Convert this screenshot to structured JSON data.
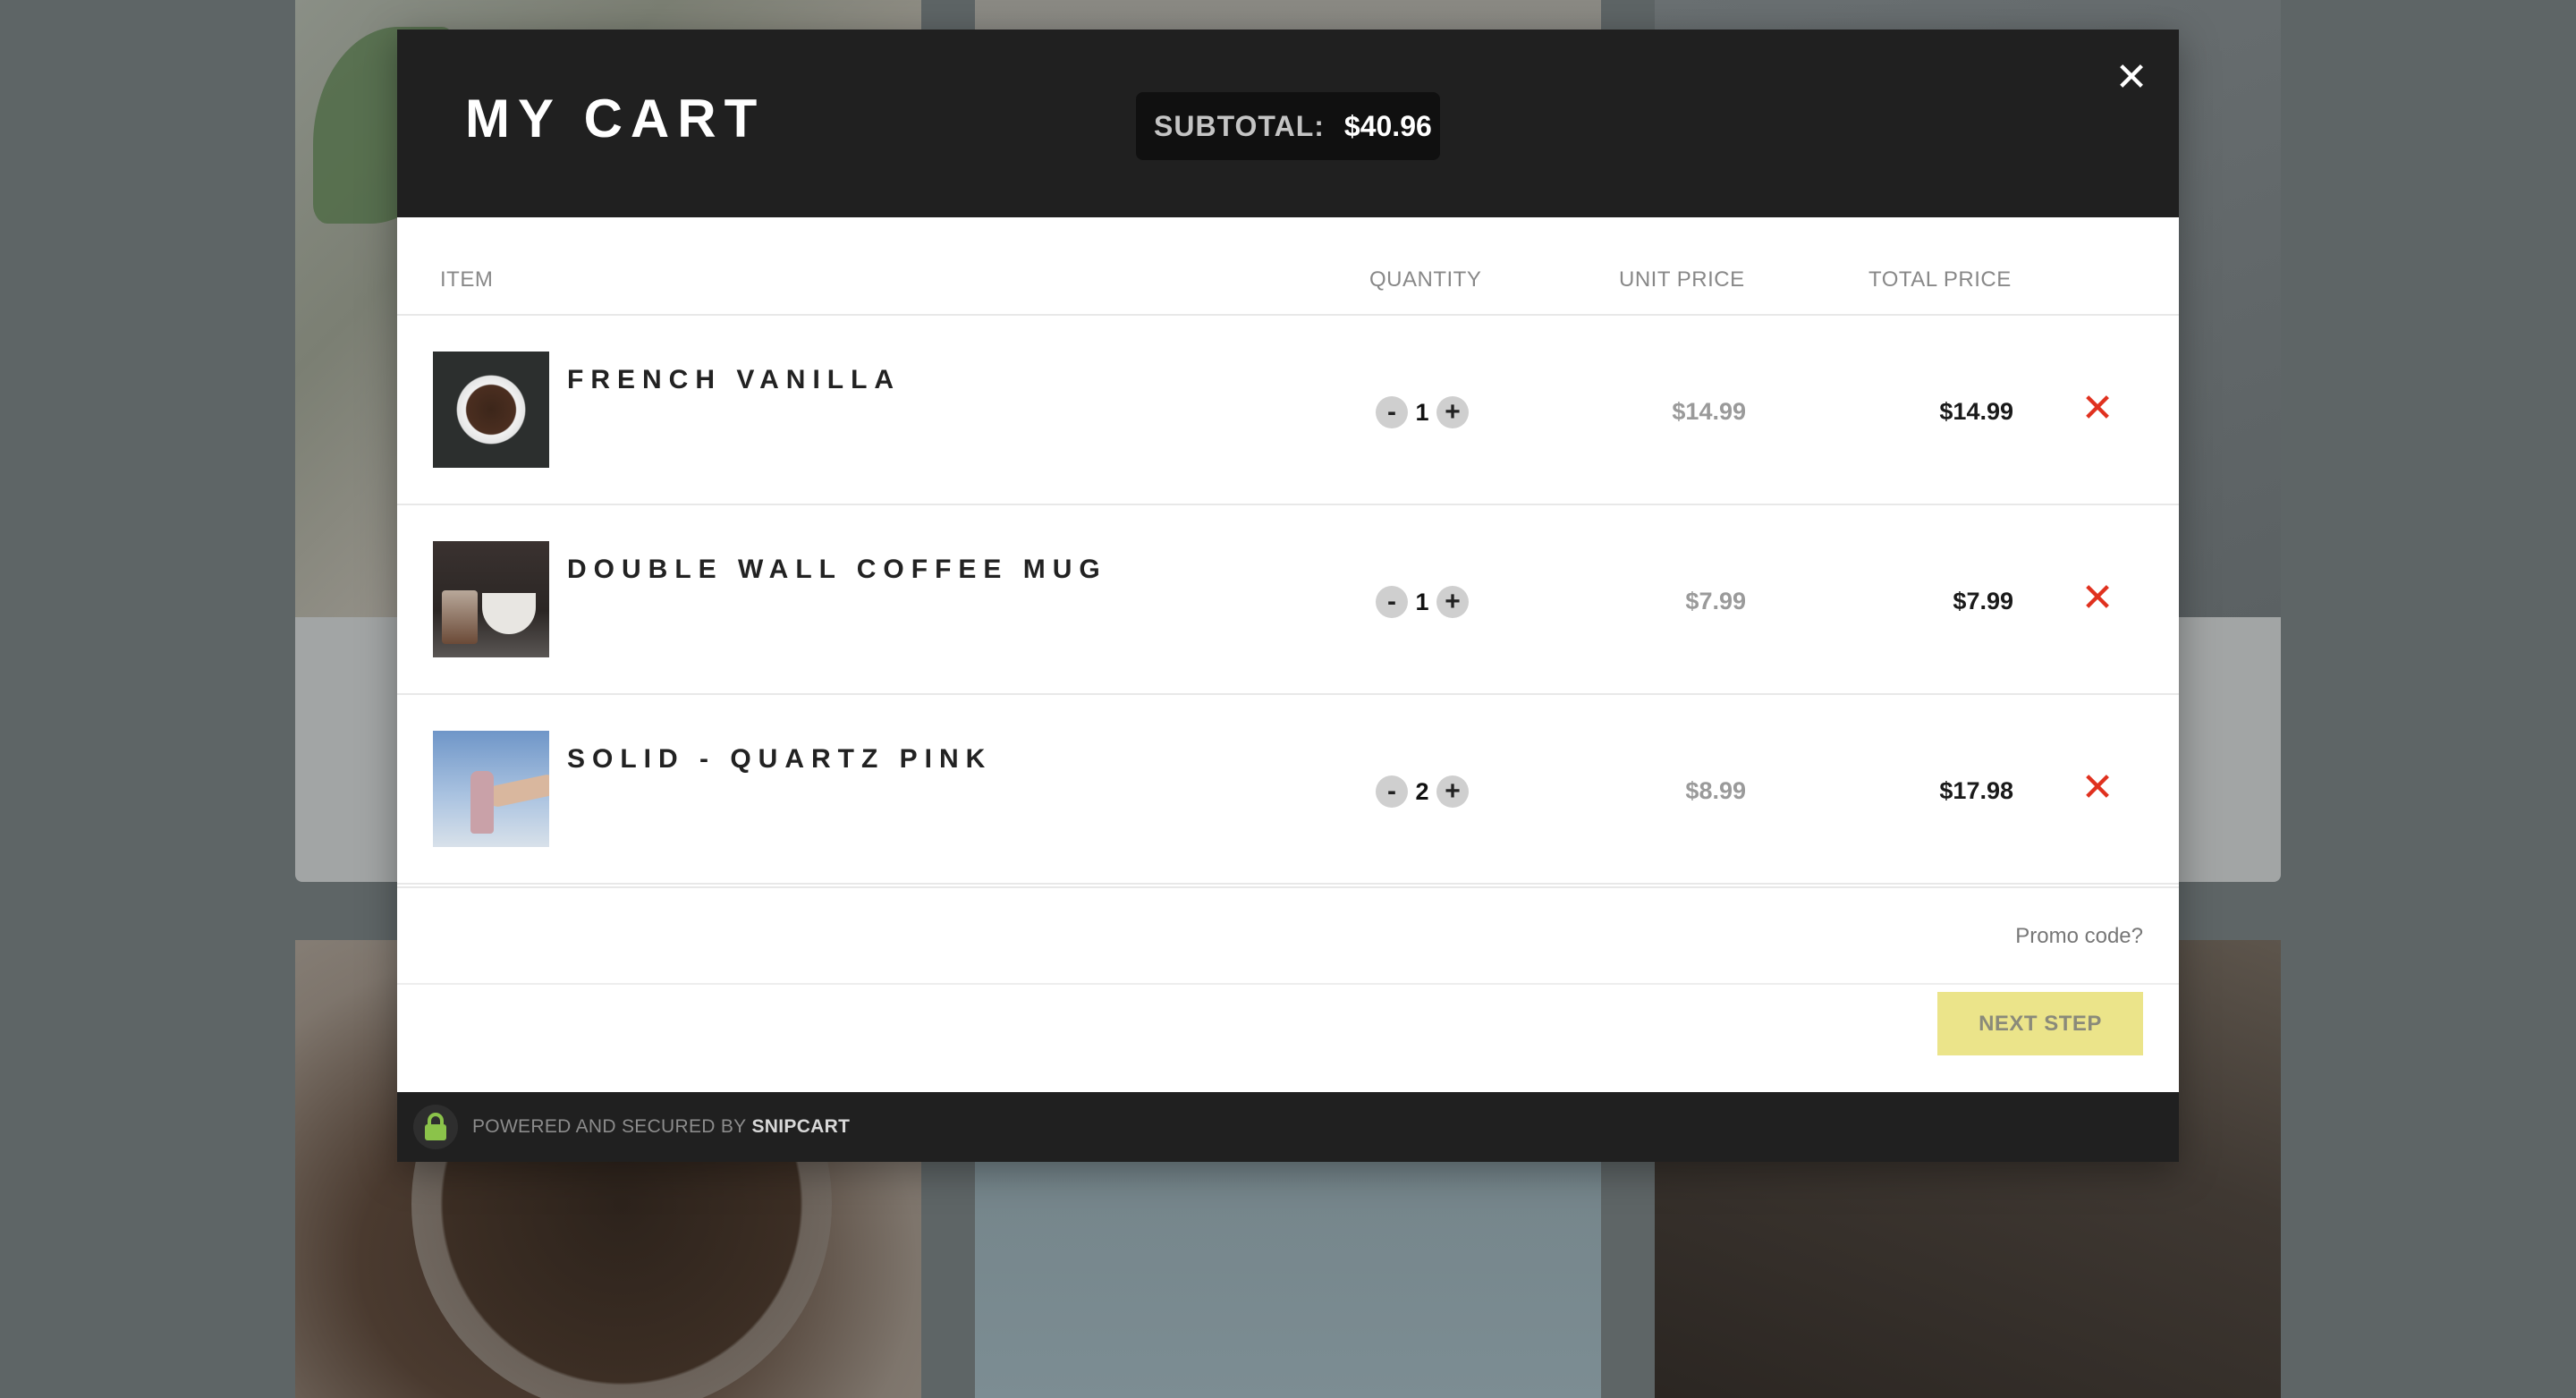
{
  "header": {
    "title": "MY CART",
    "subtotal_label": "SUBTOTAL:",
    "subtotal_value": "$40.96",
    "close_symbol": "✕"
  },
  "columns": {
    "item": "ITEM",
    "quantity": "QUANTITY",
    "unit_price": "UNIT PRICE",
    "total_price": "TOTAL PRICE"
  },
  "items": [
    {
      "name": "FRENCH VANILLA",
      "quantity": "1",
      "unit_price": "$14.99",
      "total_price": "$14.99",
      "image_icon": "coffee-cup-thumbnail"
    },
    {
      "name": "DOUBLE WALL COFFEE MUG",
      "quantity": "1",
      "unit_price": "$7.99",
      "total_price": "$7.99",
      "image_icon": "coffee-mug-thumbnail"
    },
    {
      "name": "SOLID - QUARTZ PINK",
      "quantity": "2",
      "unit_price": "$8.99",
      "total_price": "$17.98",
      "image_icon": "pink-bottle-thumbnail"
    }
  ],
  "controls": {
    "minus": "-",
    "plus": "+",
    "remove": "✕"
  },
  "promo": {
    "label": "Promo code?"
  },
  "next": {
    "label": "NEXT STEP"
  },
  "footer": {
    "text": "POWERED AND SECURED BY",
    "brand": "SNIPCART"
  },
  "colors": {
    "header_bg": "#202020",
    "remove_red": "#e0311f",
    "next_button_bg": "#ebe48a",
    "lock_green": "#8bc34a",
    "overlay": "#5e6566"
  }
}
